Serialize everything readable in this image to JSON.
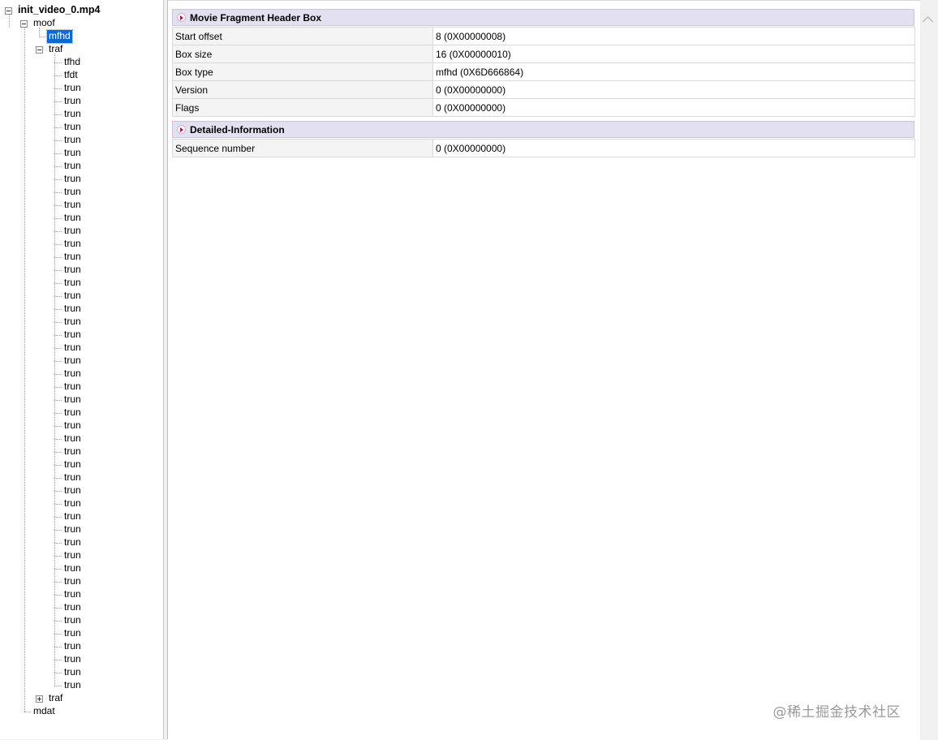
{
  "tree": {
    "root": "init_video_0.mp4",
    "moof": "moof",
    "mfhd": "mfhd",
    "traf": "traf",
    "tfhd": "tfhd",
    "tfdt": "tfdt",
    "trun_items": [
      "trun",
      "trun",
      "trun",
      "trun",
      "trun",
      "trun",
      "trun",
      "trun",
      "trun",
      "trun",
      "trun",
      "trun",
      "trun",
      "trun",
      "trun",
      "trun",
      "trun",
      "trun",
      "trun",
      "trun",
      "trun",
      "trun",
      "trun",
      "trun",
      "trun",
      "trun",
      "trun",
      "trun",
      "trun",
      "trun",
      "trun",
      "trun",
      "trun",
      "trun",
      "trun",
      "trun",
      "trun",
      "trun",
      "trun",
      "trun",
      "trun",
      "trun",
      "trun",
      "trun",
      "trun",
      "trun",
      "trun"
    ],
    "traf_collapsed": "traf",
    "mdat": "mdat",
    "selected": "mfhd"
  },
  "sections": [
    {
      "title": "Movie Fragment Header Box",
      "rows": [
        {
          "name": "Start offset",
          "value": "8 (0X00000008)"
        },
        {
          "name": "Box size",
          "value": "16 (0X00000010)"
        },
        {
          "name": "Box type",
          "value": "mfhd (0X6D666864)"
        },
        {
          "name": "Version",
          "value": "0 (0X00000000)"
        },
        {
          "name": "Flags",
          "value": "0 (0X00000000)"
        }
      ]
    },
    {
      "title": "Detailed-Information",
      "rows": [
        {
          "name": "Sequence number",
          "value": "0 (0X00000000)"
        }
      ]
    }
  ],
  "watermark": "@稀土掘金技术社区",
  "icons": {
    "section_arrow": "section-arrow-icon",
    "scroll_up": "scroll-up-icon",
    "expand": "tree-expander-icon"
  }
}
